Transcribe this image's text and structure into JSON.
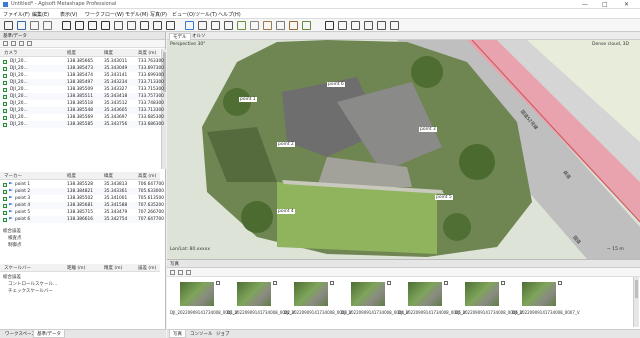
{
  "app": {
    "title": "Untitled* - Agisoft Metashape Professional",
    "window_controls": [
      "—",
      "□",
      "✕"
    ]
  },
  "menu": [
    "ファイル(F)",
    "編集(E)",
    "表示(V)",
    "ワークフロー(W)",
    "モデル(M)",
    "写真(P)",
    "ビュー(O)",
    "ツール(T)",
    "ヘルプ(H)"
  ],
  "toolbar_icons": [
    "open-icon",
    "save-icon",
    "undo-icon",
    "redo-icon",
    "select-icon",
    "rect-select-icon",
    "circle-select-icon",
    "free-select-icon",
    "move-icon",
    "rotate-icon",
    "ruler-icon",
    "polyline-icon",
    "polygon-icon",
    "marker-icon",
    "crop-icon",
    "reset-icon",
    "resize-icon",
    "point-cloud-icon",
    "mesh-icon",
    "texture-icon",
    "tiled-icon",
    "dem-icon",
    "ortho-icon",
    "camera-icon",
    "grid-icon",
    "settings-icon",
    "zoom-in-icon",
    "zoom-out-icon",
    "fullscreen-icon"
  ],
  "reference": {
    "panel_title": "基準/データ",
    "camera_columns": [
      "カメラ",
      "経度",
      "緯度",
      "高度 (m)"
    ],
    "cameras": [
      {
        "name": "DJI_20...",
        "lon": "138.385665",
        "lat": "35.343011",
        "alt": "733.763300"
      },
      {
        "name": "DJI_20...",
        "lon": "138.385473",
        "lat": "35.343049",
        "alt": "733.697300"
      },
      {
        "name": "DJI_20...",
        "lon": "138.385474",
        "lat": "35.343141",
        "alt": "733.699300"
      },
      {
        "name": "DJI_20...",
        "lon": "138.385497",
        "lat": "35.343234",
        "alt": "733.713300"
      },
      {
        "name": "DJI_20...",
        "lon": "138.385509",
        "lat": "35.343327",
        "alt": "733.715300"
      },
      {
        "name": "DJI_20...",
        "lon": "138.385511",
        "lat": "35.343418",
        "alt": "733.757300"
      },
      {
        "name": "DJI_20...",
        "lon": "138.385518",
        "lat": "35.343512",
        "alt": "733.748300"
      },
      {
        "name": "DJI_20...",
        "lon": "138.385548",
        "lat": "35.343605",
        "alt": "733.713300"
      },
      {
        "name": "DJI_20...",
        "lon": "138.385569",
        "lat": "35.343697",
        "alt": "733.685300"
      },
      {
        "name": "DJI_20...",
        "lon": "138.385585",
        "lat": "35.343756",
        "alt": "733.686300"
      }
    ],
    "marker_columns": [
      "マーカー",
      "経度",
      "緯度",
      "高度 (m)"
    ],
    "markers": [
      {
        "name": "point 1",
        "lon": "138.385528",
        "lat": "35.343813",
        "alt": "706.647700"
      },
      {
        "name": "point 2",
        "lon": "138.384821",
        "lat": "35.343361",
        "alt": "705.633000"
      },
      {
        "name": "point 3",
        "lon": "138.385502",
        "lat": "35.341001",
        "alt": "705.613500"
      },
      {
        "name": "point 4",
        "lon": "138.385681",
        "lat": "35.341588",
        "alt": "707.635200"
      },
      {
        "name": "point 5",
        "lon": "138.385715",
        "lat": "35.343479",
        "alt": "707.266700"
      },
      {
        "name": "point 6",
        "lon": "138.386616",
        "lat": "35.342754",
        "alt": "707.647700"
      }
    ],
    "total_error_label": "総合誤差",
    "error_rows": [
      "検査点",
      "制御点"
    ],
    "scalebar_columns": [
      "スケールバー",
      "距離 (m)",
      "精度 (m)",
      "誤差 (m)"
    ],
    "scalebar_error_label": "総合誤差",
    "scalebar_rows": [
      "コントロールスケール...",
      "チェックスケールバー"
    ]
  },
  "left_bottom_tabs": [
    "ワークスペース",
    "基準/データ"
  ],
  "viewport": {
    "tabs": [
      "モデル",
      "オルソ"
    ],
    "perspective_label": "Perspective 30°",
    "mode_label": "Dense cloud, 3D",
    "scale_label": "~ 15 m",
    "marker_labels": [
      "point 1",
      "point 2",
      "point 3",
      "point 4",
      "point 5",
      "point 6"
    ],
    "road_labels": [
      "県道",
      "国道52号線",
      "国道"
    ],
    "bottom_coords": "Lon/Lat: 80.xxxxx"
  },
  "photos": {
    "panel_title": "写真",
    "items": [
      "DJI_20220909141734008_0001_V",
      "DJI_20220909141734008_0002_V",
      "DJI_20220909141734008_0003_V",
      "DJI_20220909141734008_0004_V",
      "DJI_20220909141734008_0005_V",
      "DJI_20220909141734008_0006_V",
      "DJI_20220909141734008_0007_V"
    ],
    "bottom_tabs": [
      "写真",
      "コンソール",
      "ジョブ"
    ]
  },
  "colors": {
    "accent_blue": "#2f7bd6",
    "check_green": "#2b8a3e",
    "road_pink": "#e48a9b",
    "grass": "#7ea45a"
  }
}
